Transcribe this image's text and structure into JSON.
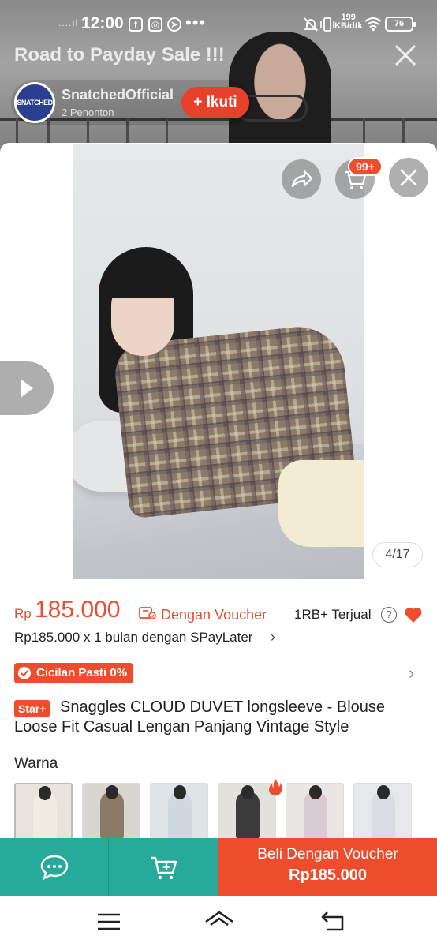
{
  "status_bar": {
    "time": "12:00",
    "signal": "....ıl",
    "app_icons": [
      "facebook-icon",
      "instagram-icon",
      "telegram-icon"
    ],
    "more": "•••",
    "network_speed_value": "199",
    "network_speed_unit": "KB/dtk",
    "battery": "76"
  },
  "live": {
    "title": "Road to Payday Sale !!!",
    "host_name": "SnatchedOfficial",
    "host_avatar_text": "SNATCHED",
    "viewers": "2 Penonton",
    "follow_label": "Ikuti",
    "follow_plus": "+"
  },
  "product": {
    "cart_badge": "99+",
    "image_counter": "4/17",
    "price_currency": "Rp",
    "price_value": "185.000",
    "voucher_label": "Dengan Voucher",
    "sold": "1RB+ Terjual",
    "help": "?",
    "spaylater": "Rp185.000 x 1 bulan dengan SPayLater",
    "spaylater_chevron": "›",
    "cicilan": "Cicilan Pasti 0%",
    "cicilan_chevron": "›",
    "star_badge": "Star+",
    "title": "Snaggles CLOUD DUVET longsleeve - Blouse Loose Fit Casual Lengan Panjang Vintage Style",
    "variant_label": "Warna",
    "variants": [
      {
        "color": "#e8e4dc",
        "fig": "#f0ece2"
      },
      {
        "color": "#d9d6cf",
        "fig": "#8a7a66"
      },
      {
        "color": "#dfe4e6",
        "fig": "#cfd8de"
      },
      {
        "color": "#e3e1dc",
        "fig": "#3b3b3b"
      },
      {
        "color": "#e9e6e3",
        "fig": "#d8cbd2"
      },
      {
        "color": "#e6e8ea",
        "fig": "#d9dde2"
      }
    ]
  },
  "actions": {
    "buy_label": "Beli Dengan Voucher",
    "buy_price": "Rp185.000"
  },
  "colors": {
    "accent": "#ee4d2d",
    "teal": "#26aa99"
  }
}
